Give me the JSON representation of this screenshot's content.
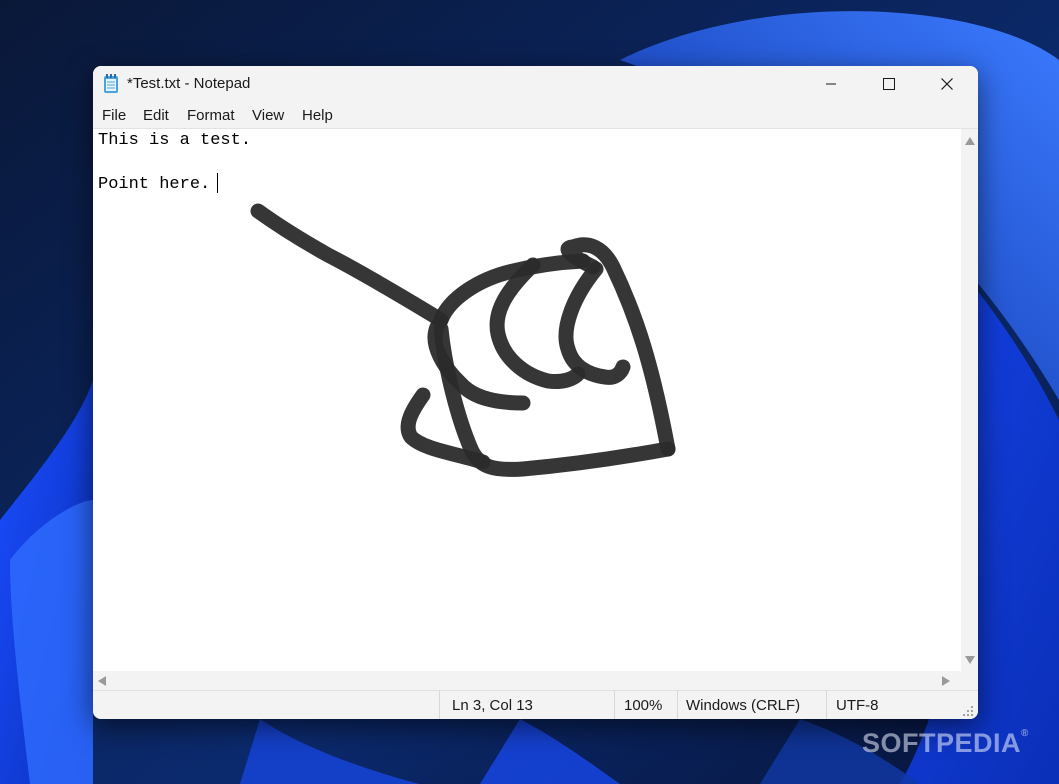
{
  "window": {
    "title": "*Test.txt - Notepad",
    "icon": "notepad-icon",
    "controls": {
      "minimize": "minimize-icon",
      "maximize": "maximize-icon",
      "close": "close-icon"
    }
  },
  "menu": {
    "items": [
      {
        "label": "File"
      },
      {
        "label": "Edit"
      },
      {
        "label": "Format"
      },
      {
        "label": "View"
      },
      {
        "label": "Help"
      }
    ]
  },
  "editor": {
    "lines": [
      "This is a test.",
      "",
      "Point here. "
    ],
    "ink_drawing": "hand pointing drawing",
    "ink_color": "#2b2b2b"
  },
  "status": {
    "position": "Ln 3, Col 13",
    "zoom": "100%",
    "line_ending": "Windows (CRLF)",
    "encoding": "UTF-8"
  },
  "watermark": {
    "text": "SOFTPEDIA",
    "mark": "®"
  },
  "colors": {
    "wallpaper_dark": "#0b1a3d",
    "wallpaper_blue": "#1e5bff",
    "chrome": "#f3f3f3"
  }
}
